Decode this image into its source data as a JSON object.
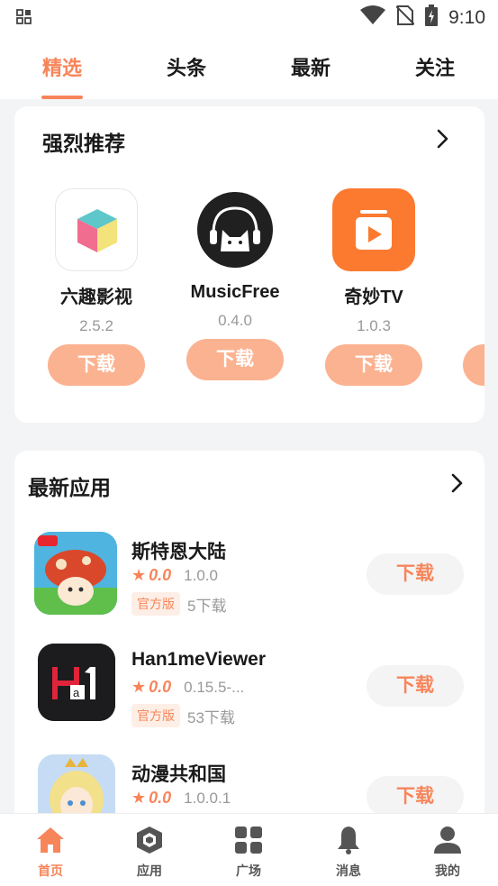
{
  "status_bar": {
    "time": "9:10",
    "icons": [
      "notification-grid-icon",
      "wifi-icon",
      "no-sim-icon",
      "battery-charging-icon"
    ]
  },
  "top_tabs": [
    {
      "label": "精选",
      "active": true
    },
    {
      "label": "头条",
      "active": false
    },
    {
      "label": "最新",
      "active": false
    },
    {
      "label": "关注",
      "active": false
    }
  ],
  "recommend": {
    "title": "强烈推荐",
    "items": [
      {
        "name": "六趣影视",
        "version": "2.5.2",
        "button": "下载",
        "icon": "cube-icon"
      },
      {
        "name": "MusicFree",
        "version": "0.4.0",
        "button": "下载",
        "icon": "cat-headphones-icon"
      },
      {
        "name": "奇妙TV",
        "version": "1.0.3",
        "button": "下载",
        "icon": "play-tv-icon"
      }
    ]
  },
  "latest": {
    "title": "最新应用",
    "apps": [
      {
        "name": "斯特恩大陆",
        "rating": "0.0",
        "version": "1.0.0",
        "tag": "官方版",
        "downloads": "5下载",
        "button": "下载",
        "icon": "mushroom-game-icon"
      },
      {
        "name": "Han1meViewer",
        "rating": "0.0",
        "version": "0.15.5-...",
        "tag": "官方版",
        "downloads": "53下载",
        "button": "下载",
        "icon": "ha1-logo-icon"
      },
      {
        "name": "动漫共和国",
        "rating": "0.0",
        "version": "1.0.0.1",
        "tag": "",
        "downloads": "",
        "button": "下载",
        "icon": "anime-character-icon"
      }
    ]
  },
  "bottom_nav": [
    {
      "label": "首页",
      "active": true,
      "icon": "home-icon"
    },
    {
      "label": "应用",
      "active": false,
      "icon": "box-icon"
    },
    {
      "label": "广场",
      "active": false,
      "icon": "grid-icon"
    },
    {
      "label": "消息",
      "active": false,
      "icon": "bell-icon"
    },
    {
      "label": "我的",
      "active": false,
      "icon": "user-icon"
    }
  ],
  "colors": {
    "accent": "#f7855a",
    "button_light": "#fbb290",
    "background": "#f3f4f6"
  }
}
